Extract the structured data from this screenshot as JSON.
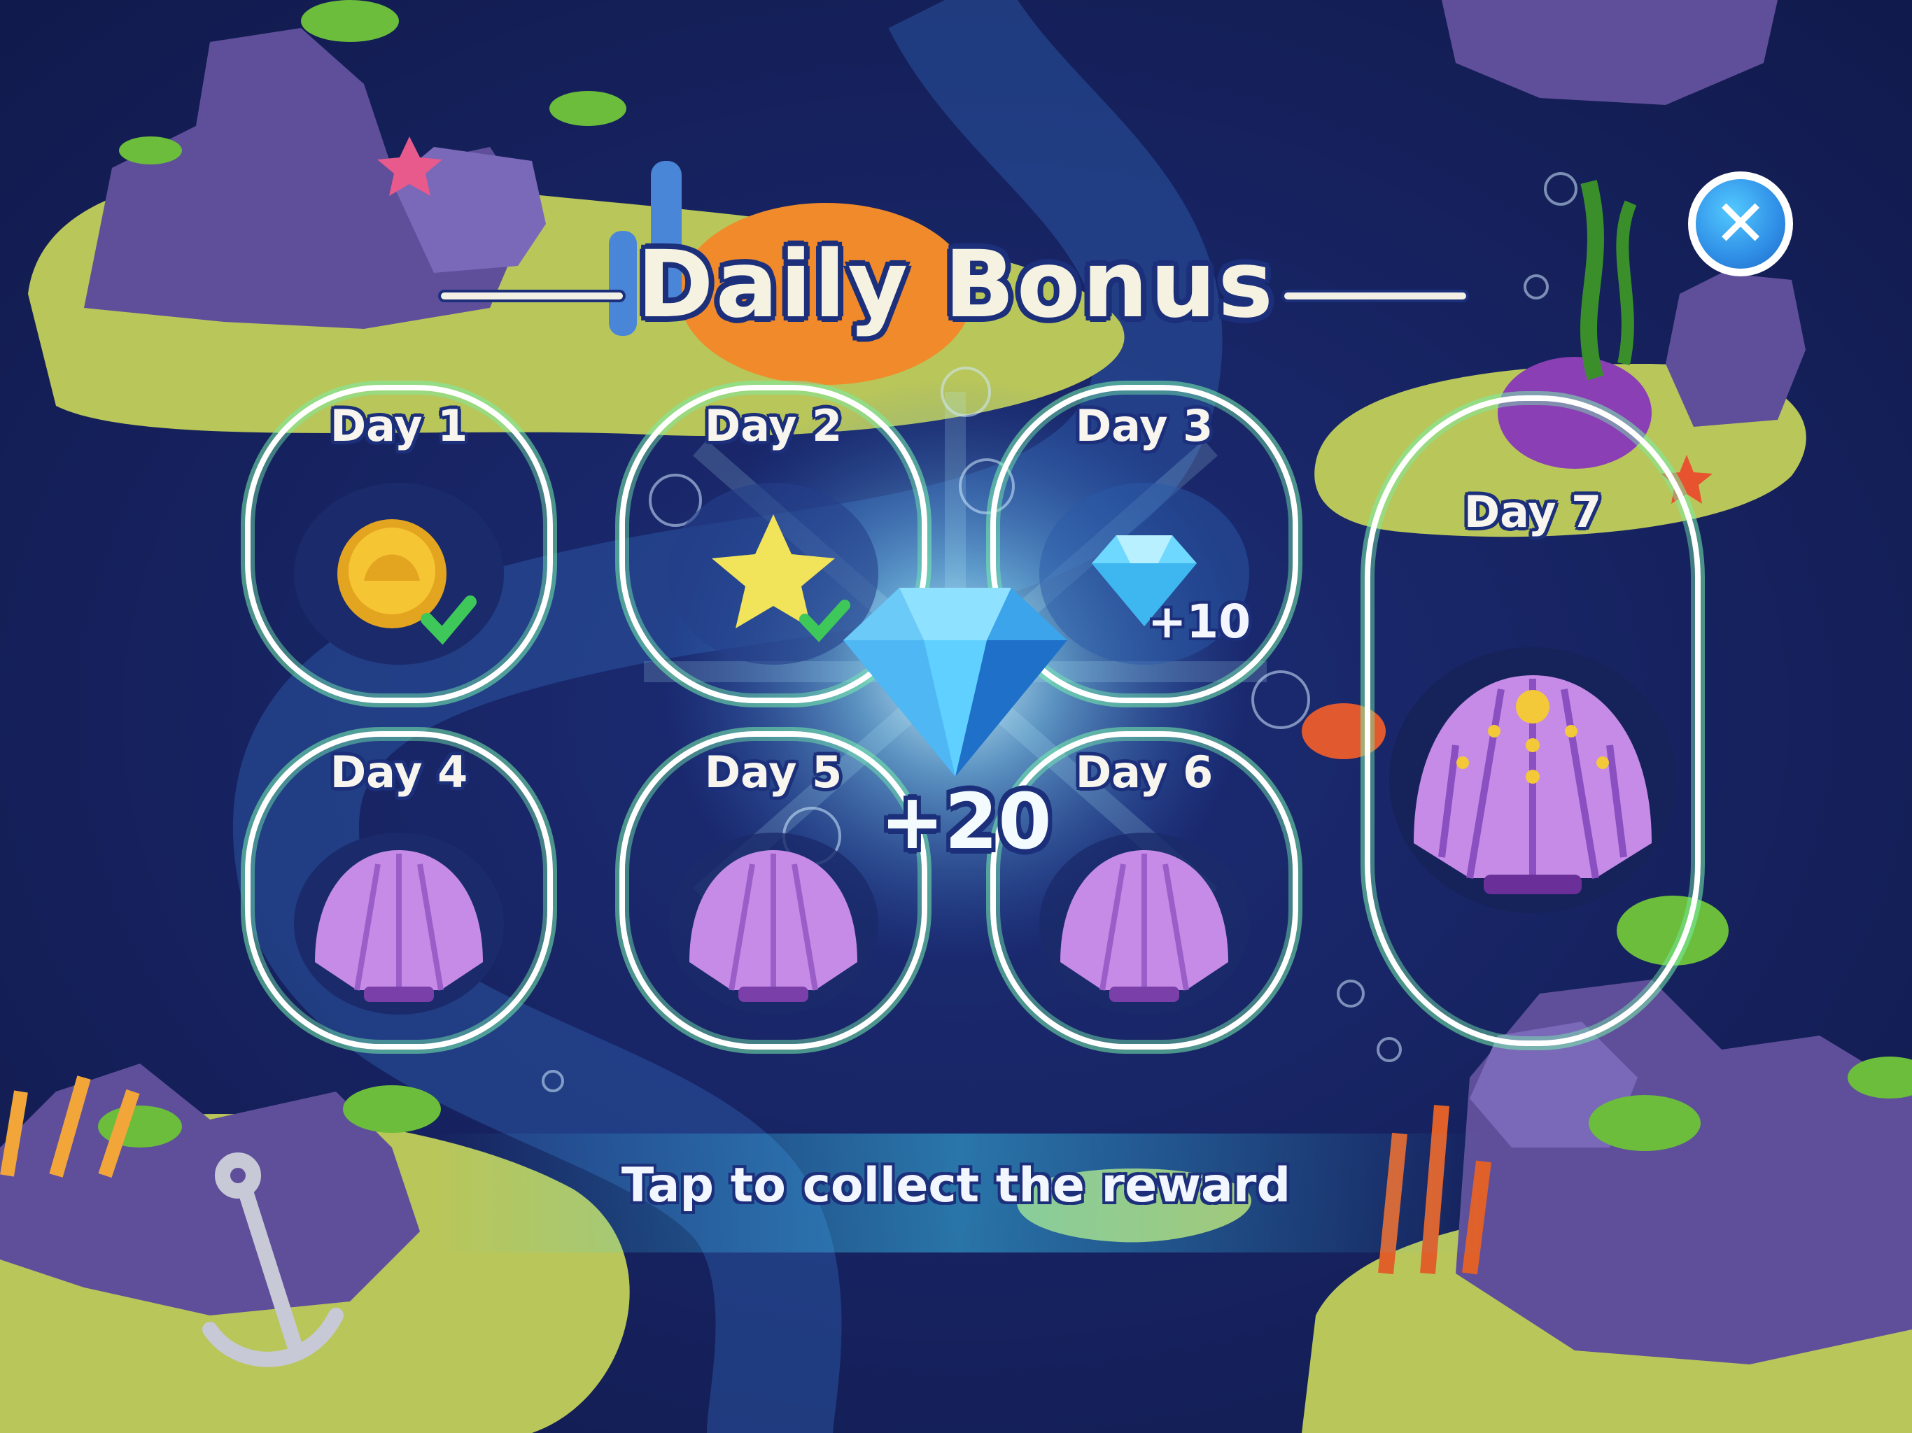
{
  "screen": {
    "title": "Daily Bonus",
    "close_icon": "close-x-icon",
    "call_to_action": "Tap to collect the reward"
  },
  "days": [
    {
      "label": "Day 1",
      "reward_icon": "gold-coin-icon",
      "claimed": true,
      "amount": ""
    },
    {
      "label": "Day 2",
      "reward_icon": "star-icon",
      "claimed": true,
      "amount": ""
    },
    {
      "label": "Day 3",
      "reward_icon": "diamond-icon",
      "claimed": false,
      "amount": "+10"
    },
    {
      "label": "Day 4",
      "reward_icon": "pink-shell-icon",
      "claimed": false,
      "amount": ""
    },
    {
      "label": "Day 5",
      "reward_icon": "pink-shell-icon",
      "claimed": false,
      "amount": ""
    },
    {
      "label": "Day 6",
      "reward_icon": "pink-shell-icon",
      "claimed": false,
      "amount": ""
    },
    {
      "label": "Day 7",
      "reward_icon": "pearl-shell-icon",
      "claimed": false,
      "amount": ""
    }
  ],
  "current_reward": {
    "icon": "blue-diamond-icon",
    "amount": "+20"
  },
  "colors": {
    "ocean": "#14205a",
    "island": "#b9c65a",
    "rock": "#5f4f9a",
    "frame": "#ffffff",
    "frame_glow": "#76f0aa",
    "text": "#f6f2e2",
    "text_outline": "#1c2f7a",
    "gem": "#4fc6ff",
    "coin": "#f0b72a",
    "shell": "#c58be6",
    "close_button": "#2f8ee6"
  }
}
